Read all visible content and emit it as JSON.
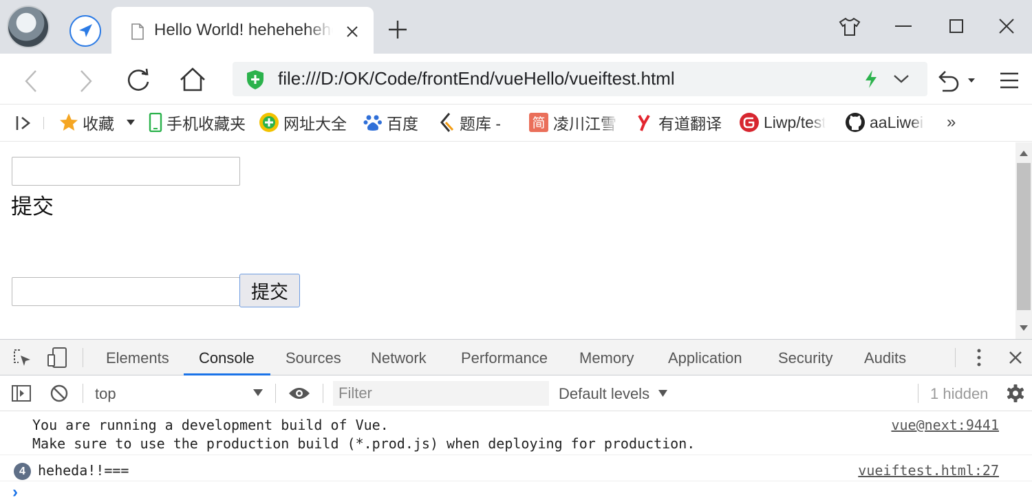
{
  "browser": {
    "tab_title": "Hello World! hehehehehe",
    "url": "file:///D:/OK/Code/frontEnd/vueHello/vueiftest.html",
    "bookmarks": [
      {
        "label": "收藏"
      },
      {
        "label": "手机收藏夹"
      },
      {
        "label": "网址大全"
      },
      {
        "label": "百度"
      },
      {
        "label": "题库 -"
      },
      {
        "label": "凌川江雪"
      },
      {
        "label": "有道翻译"
      },
      {
        "label": "Liwp/test"
      },
      {
        "label": "aaLiwei"
      }
    ],
    "more_bookmarks": "»"
  },
  "page": {
    "label_submit": "提交",
    "button_submit": "提交"
  },
  "devtools": {
    "tabs": [
      "Elements",
      "Console",
      "Sources",
      "Network",
      "Performance",
      "Memory",
      "Application",
      "Security",
      "Audits"
    ],
    "context": "top",
    "filter_placeholder": "Filter",
    "levels": "Default levels",
    "hidden_count": "1 hidden",
    "messages": [
      {
        "line1": "You are running a development build of Vue.",
        "line2": "Make sure to use the production build (*.prod.js) when deploying for production.",
        "source": "vue@next:9441"
      },
      {
        "count": "4",
        "text": "heheda!!===",
        "source": "vueiftest.html:27"
      }
    ],
    "prompt": "›"
  },
  "colors": {
    "accent": "#1a73e8",
    "titlebar": "#dee1e6"
  }
}
